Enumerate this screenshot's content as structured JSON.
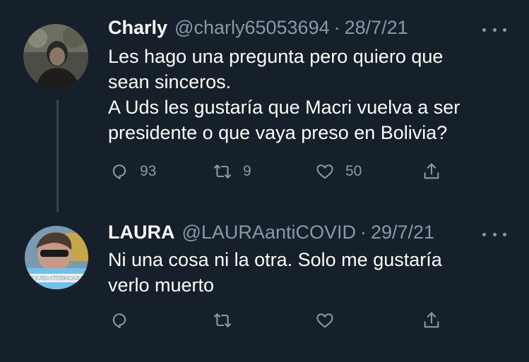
{
  "tweets": [
    {
      "name": "Charly",
      "handle": "@charly65053694",
      "separator": "·",
      "date": "28/7/21",
      "text_lines": [
        "Les hago una pregunta pero quiero que",
        "sean sinceros.",
        "A Uds les gustaría que Macri vuelva a ser",
        "presidente o que vaya preso en Bolivia?"
      ],
      "replies": "93",
      "retweets": "9",
      "likes": "50"
    },
    {
      "name": "LAURA",
      "handle": "@LAURAantiCOVID",
      "separator": "·",
      "date": "29/7/21",
      "text_lines": [
        "Ni una cosa ni la otra. Solo me gustaría",
        "verlo muerto"
      ],
      "avatar_badge": "#QUEDATEENCASA"
    }
  ],
  "colors": {
    "background": "#15202b",
    "text": "#ffffff",
    "secondary": "#8b98a5",
    "thread_line": "#38444d"
  },
  "icons": [
    "reply-icon",
    "retweet-icon",
    "like-icon",
    "share-icon",
    "more-icon"
  ]
}
